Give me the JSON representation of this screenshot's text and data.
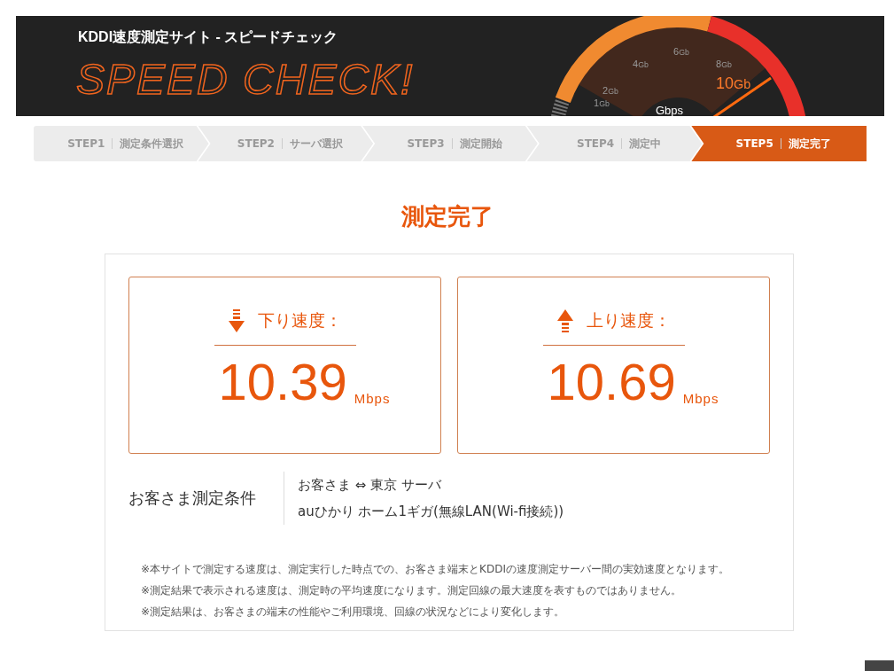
{
  "header": {
    "site_title": "KDDI速度測定サイト - スピードチェック",
    "logo_text": "SPEED CHECK!",
    "gauge": {
      "ticks": [
        {
          "number": "1",
          "unit": "Gb"
        },
        {
          "number": "2",
          "unit": "Gb"
        },
        {
          "number": "4",
          "unit": "Gb"
        },
        {
          "number": "6",
          "unit": "Gb"
        },
        {
          "number": "8",
          "unit": "Gb"
        },
        {
          "number": "10",
          "unit": "Gb"
        }
      ],
      "unit_label": "Gbps"
    }
  },
  "steps": [
    {
      "number": "STEP1",
      "label": "測定条件選択",
      "selected": false
    },
    {
      "number": "STEP2",
      "label": "サーバ選択",
      "selected": false
    },
    {
      "number": "STEP3",
      "label": "測定開始",
      "selected": false
    },
    {
      "number": "STEP4",
      "label": "測定中",
      "selected": false
    },
    {
      "number": "STEP5",
      "label": "測定完了",
      "selected": true
    }
  ],
  "heading": "測定完了",
  "results": [
    {
      "kind": "download",
      "label": "下り速度：",
      "value": "10.39",
      "unit": "Mbps"
    },
    {
      "kind": "upload",
      "label": "上り速度：",
      "value": "10.69",
      "unit": "Mbps"
    }
  ],
  "conditions": {
    "label": "お客さま測定条件",
    "lines": [
      "お客さま ⇔ 東京 サーバ",
      "auひかり ホーム1ギガ(無線LAN(Wi-fi接続))"
    ]
  },
  "notes": [
    "※本サイトで測定する速度は、測定実行した時点での、お客さま端末とKDDIの速度測定サーバー間の実効速度となります。",
    "※測定結果で表示される速度は、測定時の平均速度になります。測定回線の最大速度を表すものではありません。",
    "※測定結果は、お客さまの端末の性能やご利用環境、回線の状況などにより変化します。"
  ]
}
